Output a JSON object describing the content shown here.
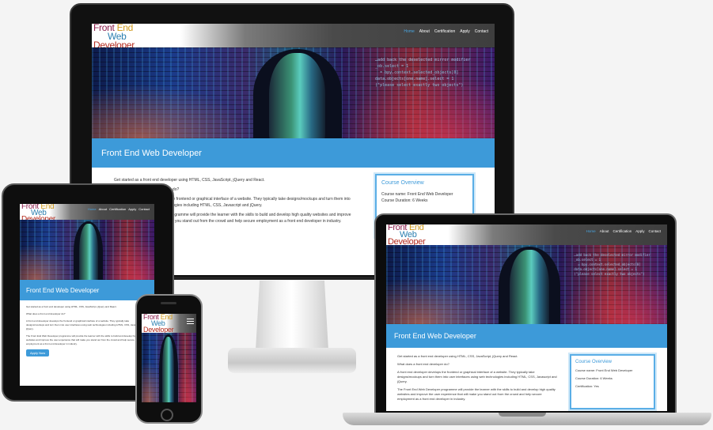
{
  "site": {
    "logo": {
      "line1_a": "Front",
      "line1_b": "End",
      "line2": "Web",
      "line3": "Developer"
    },
    "nav": [
      "Home",
      "About",
      "Certification",
      "Apply",
      "Contact"
    ],
    "banner_title": "Front End Web Developer",
    "hero_code": "…add back the deselected mirror modifier\n_ob.select = 1\n  = bpy.context.selected_objects[0]\ndata.objects[one.name].select = 1\n(\"please select exactly two objects\")",
    "intro": "Get started as a front end developer using HTML, CSS, JavaScript, jQuery and React.",
    "question": "What does a front end developer do?",
    "para1": "A front end developer develops the frontend or graphical interface of a website. They typically take designs/mockups and turn them into user interfaces using web technologies including HTML, CSS, Javascript and jQuery.",
    "para2": "The Front End Web Developer programme will provide the learner with the skills to build and develop high quality websites and improve the user experience that will make you stand out from the crowd and help secure employment as a front end developer in industry.",
    "button": "Apply Now",
    "overview": {
      "title": "Course Overview",
      "items": [
        "Course name: Front End Web Developer",
        "Course Duration: 6 Weeks",
        "Certification: Yes"
      ]
    }
  }
}
